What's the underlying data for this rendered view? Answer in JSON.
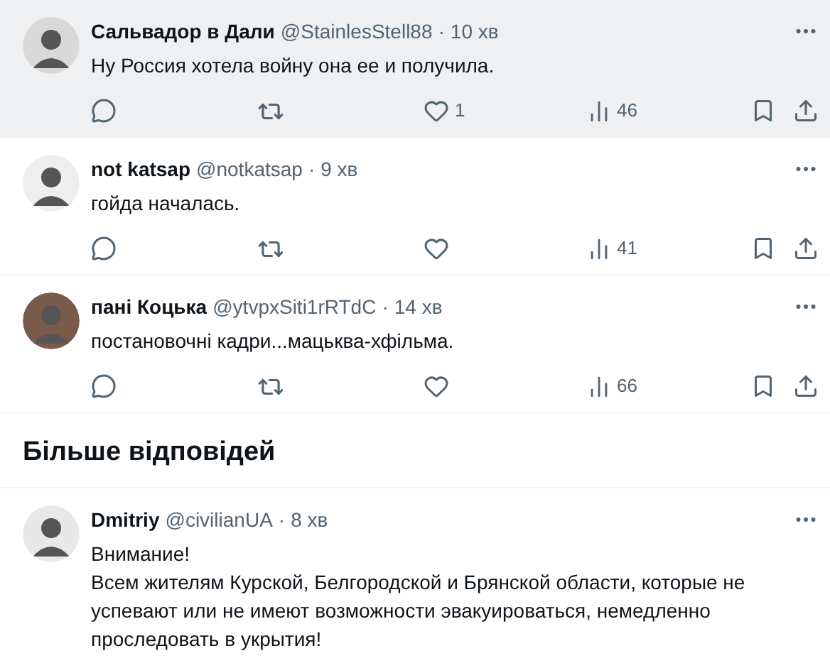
{
  "tweets": [
    {
      "name": "Сальвадор в Дали",
      "handle": "@StainlesStell88",
      "separator": "·",
      "time": "10 хв",
      "text": "Ну Россия хотела войну она ее и получила.",
      "likes": "1",
      "views": "46",
      "highlighted": true
    },
    {
      "name": "not katsap",
      "handle": "@notkatsap",
      "separator": "·",
      "time": "9 хв",
      "text": "гойда началась.",
      "views": "41",
      "highlighted": false
    },
    {
      "name": "пані Коцька",
      "handle": "@ytvpxSiti1rRTdC",
      "separator": "·",
      "time": "14 хв",
      "text": "постановочні кадри...мацьква-хфільма.",
      "views": "66",
      "highlighted": false
    }
  ],
  "more_replies_heading": "Більше відповідей",
  "last_tweet": {
    "name": "Dmitriy",
    "handle": "@civilianUA",
    "separator": "·",
    "time": "8 хв",
    "text": "Внимание!\nВсем жителям Курской, Белгородской и Брянской области, которые не успевают или не имеют возможности эвакуироваться, немедленно проследовать в укрытия!"
  }
}
